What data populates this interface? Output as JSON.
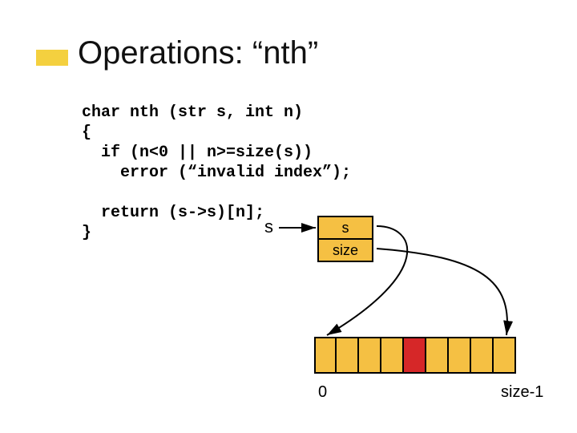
{
  "title": "Operations: “nth”",
  "code": {
    "l1": "char nth (str s, int n)",
    "l2": "{",
    "l3": "  if (n<0 || n>=size(s))",
    "l4": "    error (“invalid index”);",
    "blank": "",
    "l5": "  return (s->s)[n];",
    "l6": "}"
  },
  "diagram": {
    "pointer_var": "s",
    "struct_fields": {
      "s": "s",
      "size": "size"
    },
    "array": {
      "cell_count": 9,
      "highlight_index": 4,
      "label_left": "0",
      "label_right": "size-1"
    }
  }
}
